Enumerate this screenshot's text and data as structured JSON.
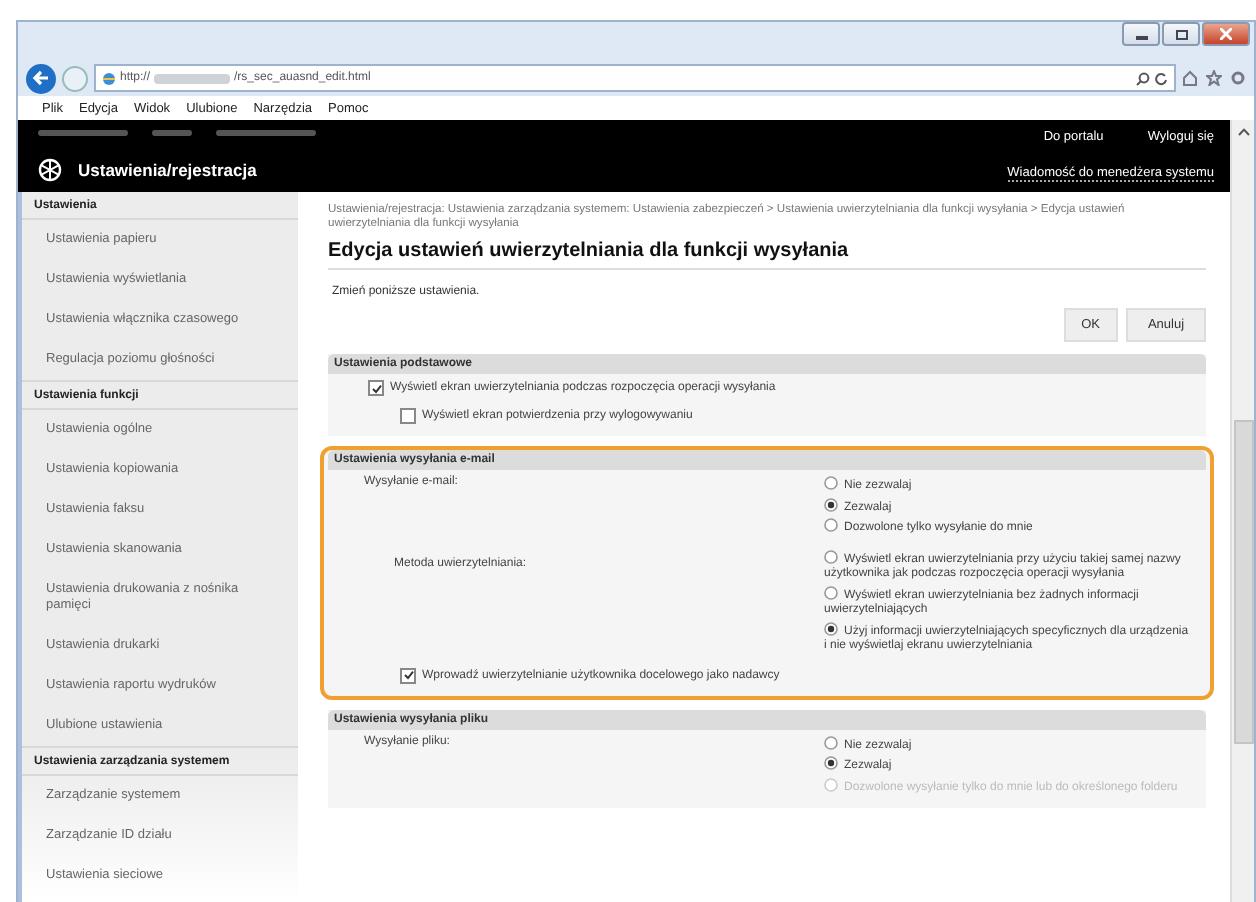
{
  "browser": {
    "url_scheme": "http://",
    "url_path": "/rs_sec_auasnd_edit.html",
    "menu": [
      "Plik",
      "Edycja",
      "Widok",
      "Ulubione",
      "Narzędzia",
      "Pomoc"
    ]
  },
  "header": {
    "title": "Ustawienia/rejestracja",
    "links": [
      "Do portalu",
      "Wyloguj się",
      "Wiadomość do menedżera systemu"
    ]
  },
  "sidebar": {
    "groups": [
      {
        "title": "Ustawienia",
        "items": [
          "Ustawienia papieru",
          "Ustawienia wyświetlania",
          "Ustawienia włącznika czasowego",
          "Regulacja poziomu głośności"
        ]
      },
      {
        "title": "Ustawienia funkcji",
        "items": [
          "Ustawienia ogólne",
          "Ustawienia kopiowania",
          "Ustawienia faksu",
          "Ustawienia skanowania",
          "Ustawienia drukowania z nośnika pamięci",
          "Ustawienia drukarki",
          "Ustawienia raportu wydruków",
          "Ulubione ustawienia"
        ]
      },
      {
        "title": "Ustawienia zarządzania systemem",
        "items": [
          "Zarządzanie systemem",
          "Zarządzanie ID działu",
          "Ustawienia sieciowe"
        ]
      }
    ]
  },
  "breadcrumb": "Ustawienia/rejestracja: Ustawienia zarządzania systemem: Ustawienia zabezpieczeń > Ustawienia uwierzytelniania dla funkcji wysyłania > Edycja ustawień uwierzytelniania dla funkcji wysyłania",
  "page_title": "Edycja ustawień uwierzytelniania dla funkcji wysyłania",
  "instruction": "Zmień poniższe ustawienia.",
  "buttons": [
    "OK",
    "Anuluj"
  ],
  "sections": [
    {
      "title": "Ustawienia podstawowe",
      "highlighted": false,
      "rows": [
        {
          "kind": "checkbox",
          "label": "Wyświetl ekran uwierzytelniania podczas rozpoczęcia operacji wysyłania",
          "checked": true,
          "children": [
            {
              "kind": "checkbox",
              "label": "Wyświetl ekran potwierdzenia przy wylogowywaniu",
              "checked": false
            }
          ]
        }
      ]
    },
    {
      "title": "Ustawienia wysyłania e-mail",
      "highlighted": true,
      "rows": [
        {
          "kind": "radio-group",
          "label": "Wysyłanie e-mail:",
          "options": [
            {
              "label": "Nie zezwalaj",
              "selected": false,
              "disabled": false
            },
            {
              "label": "Zezwalaj",
              "selected": true,
              "disabled": false
            },
            {
              "label": "Dozwolone tylko wysyłanie do mnie",
              "selected": false,
              "disabled": false
            }
          ]
        },
        {
          "kind": "sub-radio-group",
          "label": "Metoda uwierzytelniania:",
          "options": [
            {
              "label": "Wyświetl ekran uwierzytelniania przy użyciu takiej samej nazwy użytkownika jak podczas rozpoczęcia operacji wysyłania",
              "selected": false,
              "disabled": false
            },
            {
              "label": "Wyświetl ekran uwierzytelniania bez żadnych informacji uwierzytelniających",
              "selected": false,
              "disabled": false
            },
            {
              "label": "Użyj informacji uwierzytelniających specyficznych dla urządzenia i nie wyświetlaj ekranu uwierzytelniania",
              "selected": true,
              "disabled": false
            }
          ]
        },
        {
          "kind": "checkbox",
          "label": "Wprowadź uwierzytelnianie użytkownika docelowego jako nadawcy",
          "checked": true
        }
      ]
    },
    {
      "title": "Ustawienia wysyłania pliku",
      "highlighted": false,
      "rows": [
        {
          "kind": "radio-group",
          "label": "Wysyłanie pliku:",
          "options": [
            {
              "label": "Nie zezwalaj",
              "selected": false,
              "disabled": false
            },
            {
              "label": "Zezwalaj",
              "selected": true,
              "disabled": false
            },
            {
              "label": "Dozwolone wysyłanie tylko do mnie lub do określonego folderu",
              "selected": false,
              "disabled": true
            }
          ]
        }
      ]
    }
  ]
}
